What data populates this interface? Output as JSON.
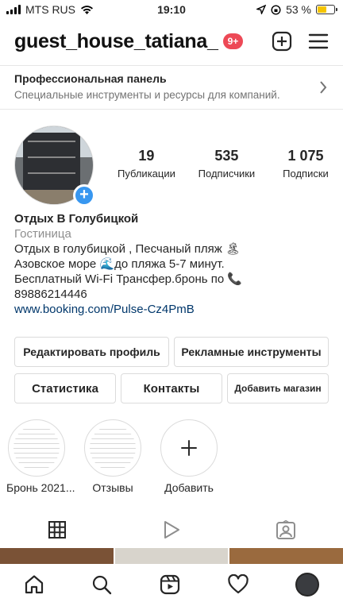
{
  "status": {
    "carrier": "MTS RUS",
    "time": "19:10",
    "battery": "53 %",
    "battery_level": 0.53
  },
  "header": {
    "username": "guest_house_tatiana_",
    "notifications": "9+"
  },
  "pro_panel": {
    "title": "Профессиональная панель",
    "subtitle": "Специальные инструменты и ресурсы для компаний."
  },
  "stats": [
    {
      "value": "19",
      "label": "Публикации"
    },
    {
      "value": "535",
      "label": "Подписчики"
    },
    {
      "value": "1 075",
      "label": "Подписки"
    }
  ],
  "bio": {
    "name": "Отдых В Голубицкой",
    "category": "Гостиница",
    "lines": [
      "Отдых в голубицкой , Песчаный пляж 🏝",
      "Азовское море 🌊до пляжа 5-7 минут.",
      "Бесплатный Wi-Fi Трансфер.бронь по 📞",
      "89886214446"
    ],
    "link": "www.booking.com/Pulse-Cz4PmB"
  },
  "buttons": {
    "edit_profile": "Редактировать профиль",
    "ad_tools": "Рекламные инструменты",
    "statistics": "Статистика",
    "contacts": "Контакты",
    "add_shop": "Добавить магазин"
  },
  "highlights": [
    {
      "label": "Бронь 2021..."
    },
    {
      "label": "Отзывы"
    },
    {
      "label": "Добавить"
    }
  ],
  "colors": {
    "accent": "#3897f0",
    "badge": "#ed4956",
    "link": "#00376b"
  }
}
